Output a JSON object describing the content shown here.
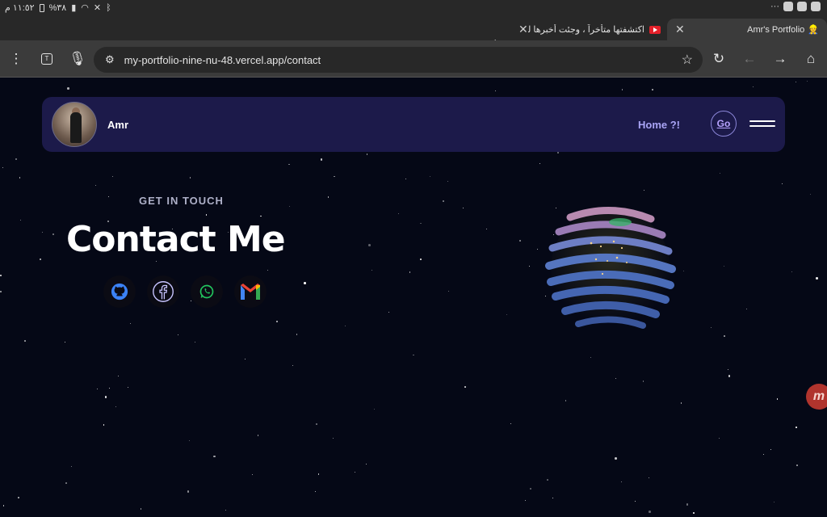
{
  "status_bar": {
    "time": "١١:٥٢ م",
    "battery": "%٣٨"
  },
  "browser": {
    "tabs": [
      {
        "title": "Amr's Portfolio",
        "active": true
      },
      {
        "title": "اكتشفتها متأخراً ، وجئت أخبرها لك",
        "active": false
      }
    ],
    "url": "my-portfolio-nine-nu-48.vercel.app/contact"
  },
  "site": {
    "brand": "Amr",
    "nav_link": "Home ?!",
    "go_button": "Go",
    "subtitle": "GET IN TOUCH",
    "title": "Contact Me",
    "socials": [
      {
        "name": "GitHub",
        "icon": "github-icon",
        "color": "#3b82f6"
      },
      {
        "name": "Facebook",
        "icon": "facebook-icon",
        "color": "#c7c4ff"
      },
      {
        "name": "WhatsApp",
        "icon": "whatsapp-icon",
        "color": "#22c55e"
      },
      {
        "name": "Gmail",
        "icon": "gmail-icon",
        "color": "#ea4335"
      }
    ],
    "floating_badge": "m"
  },
  "colors": {
    "page_bg": "#050816",
    "navbar_bg": "#1c1a4a",
    "accent": "#a9a4f5"
  }
}
